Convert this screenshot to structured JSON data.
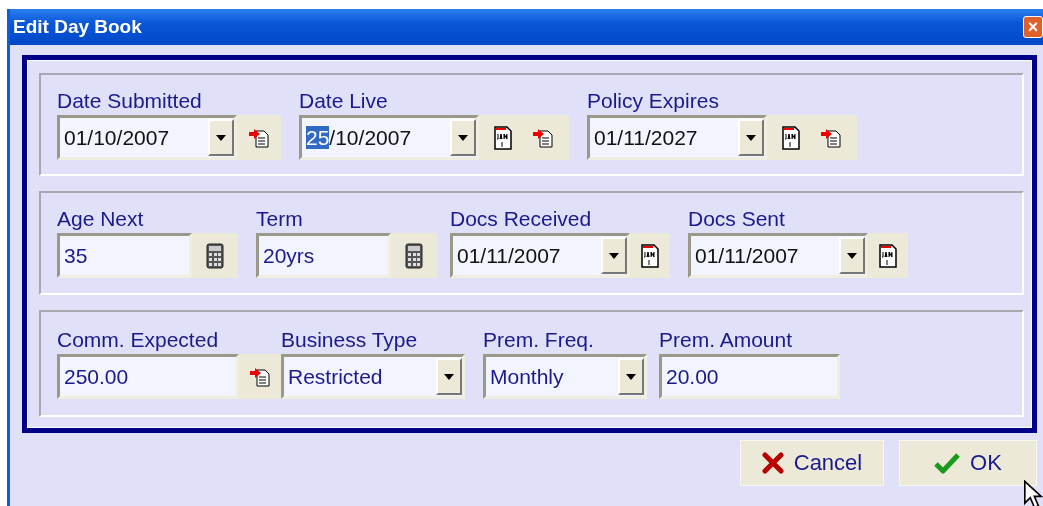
{
  "window": {
    "title": "Edit Day Book",
    "close": "×"
  },
  "groups": [
    {
      "fields": [
        {
          "kind": "date",
          "label": "Date Submitted",
          "value": [
            {
              "text": "01/10/2007",
              "selected": false
            }
          ],
          "tools": [
            {
              "kind": "arrow-doc"
            }
          ]
        },
        {
          "kind": "date",
          "label": "Date Live",
          "value": [
            {
              "text": "25",
              "selected": true
            },
            {
              "text": "/10/2007",
              "selected": false
            }
          ],
          "tools": [
            {
              "kind": "calendar"
            },
            {
              "kind": "arrow-doc"
            }
          ]
        },
        {
          "kind": "date",
          "label": "Policy Expires",
          "value": [
            {
              "text": "01/11/2027",
              "selected": false
            }
          ],
          "tools": [
            {
              "kind": "calendar"
            },
            {
              "kind": "arrow-doc"
            }
          ]
        }
      ]
    },
    {
      "fields": [
        {
          "kind": "text",
          "label": "Age Next",
          "value": [
            {
              "text": "35",
              "selected": false
            }
          ],
          "tools": [
            {
              "kind": "calculator"
            }
          ]
        },
        {
          "kind": "text",
          "label": "Term",
          "value": [
            {
              "text": "20yrs",
              "selected": false
            }
          ],
          "tools": [
            {
              "kind": "calculator"
            }
          ]
        },
        {
          "kind": "date",
          "label": "Docs Received",
          "value": [
            {
              "text": "01/11/2007",
              "selected": false
            }
          ],
          "tools": [
            {
              "kind": "calendar"
            }
          ]
        },
        {
          "kind": "date",
          "label": "Docs Sent",
          "value": [
            {
              "text": "01/11/2007",
              "selected": false
            }
          ],
          "tools": [
            {
              "kind": "calendar"
            }
          ]
        }
      ]
    },
    {
      "fields": [
        {
          "kind": "text",
          "label": "Comm. Expected",
          "value": [
            {
              "text": "250.00",
              "selected": false
            }
          ],
          "tools": [
            {
              "kind": "arrow-doc"
            }
          ]
        },
        {
          "kind": "combo",
          "label": "Business Type",
          "value": [
            {
              "text": "Restricted",
              "selected": false
            }
          ]
        },
        {
          "kind": "combo",
          "label": "Prem. Freq.",
          "value": [
            {
              "text": "Monthly",
              "selected": false
            }
          ]
        },
        {
          "kind": "text",
          "label": "Prem. Amount",
          "value": [
            {
              "text": "20.00",
              "selected": false
            }
          ]
        }
      ]
    }
  ],
  "buttons": [
    {
      "kind": "cancel",
      "label": "Cancel"
    },
    {
      "kind": "ok",
      "label": "OK"
    }
  ]
}
